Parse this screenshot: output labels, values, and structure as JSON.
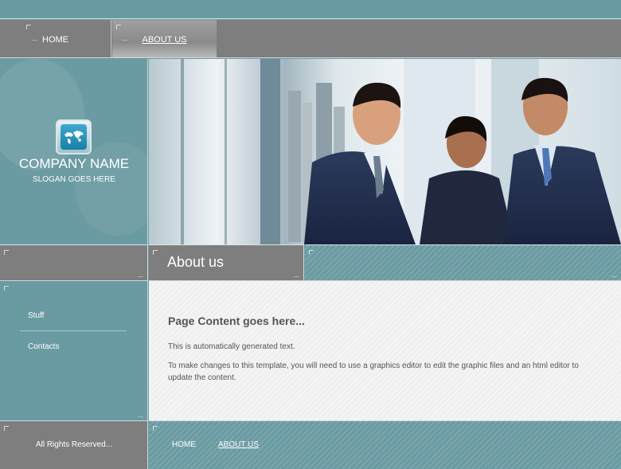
{
  "nav": {
    "home": "HOME",
    "about": "ABOUT US"
  },
  "brand": {
    "company": "COMPANY NAME",
    "slogan": "SLOGAN GOES HERE",
    "logo_icon": "world-map-icon"
  },
  "section_title": "About us",
  "sidebar": {
    "items": [
      {
        "label": "Stuff"
      },
      {
        "label": "Contacts"
      }
    ]
  },
  "content": {
    "heading": "Page Content goes here...",
    "p1": "This is automatically generated text.",
    "p2": "To make changes to this template, you will need to use a graphics editor to edit the graphic files and an html editor to update the content."
  },
  "footer": {
    "copyright": "All Rights Reserved...",
    "home": "HOME",
    "about": "ABOUT US"
  },
  "colors": {
    "teal": "#6a9aa2",
    "gray": "#7e7e7e",
    "content_bg": "#f2f2f2"
  }
}
